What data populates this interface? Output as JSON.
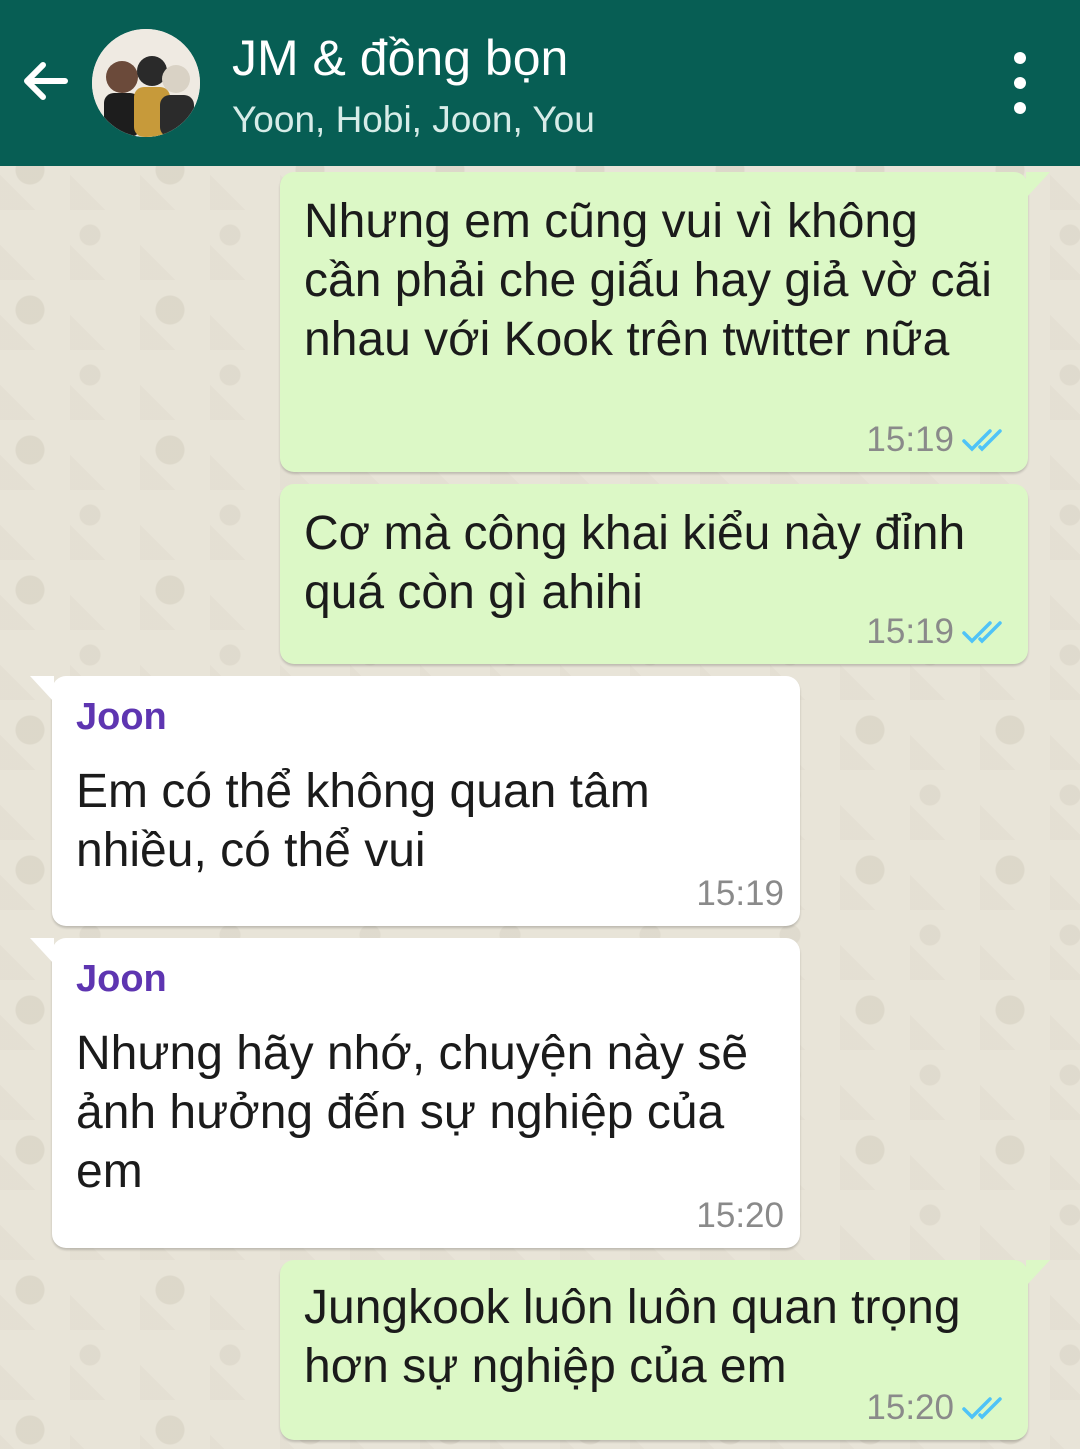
{
  "header": {
    "title": "JM & đồng bọn",
    "subtitle": "Yoon, Hobi, Joon, You",
    "back_icon": "arrow-back-icon",
    "menu_icon": "more-vertical-icon",
    "bar_color": "#075e54"
  },
  "messages": [
    {
      "direction": "outgoing",
      "text": "Nhưng em cũng vui vì không cần phải che giấu hay giả vờ cãi nhau với Kook trên twitter nữa",
      "time": "15:19",
      "status": "read"
    },
    {
      "direction": "outgoing",
      "text": "Cơ mà công khai kiểu này đỉnh quá còn gì ahihi",
      "time": "15:19",
      "status": "read"
    },
    {
      "direction": "incoming",
      "sender": "Joon",
      "text": "Em có thể không quan tâm nhiều, có thể vui",
      "time": "15:19"
    },
    {
      "direction": "incoming",
      "sender": "Joon",
      "text": "Nhưng hãy nhớ, chuyện này sẽ ảnh hưởng đến sự nghiệp của em",
      "time": "15:20"
    },
    {
      "direction": "outgoing",
      "text": "Jungkook luôn luôn quan trọng hơn sự nghiệp của em",
      "time": "15:20",
      "status": "read"
    }
  ],
  "colors": {
    "outgoing_bubble": "#dcf8c6",
    "incoming_bubble": "#ffffff",
    "sender_name": "#5e35b1",
    "read_ticks": "#4fc3f7"
  }
}
